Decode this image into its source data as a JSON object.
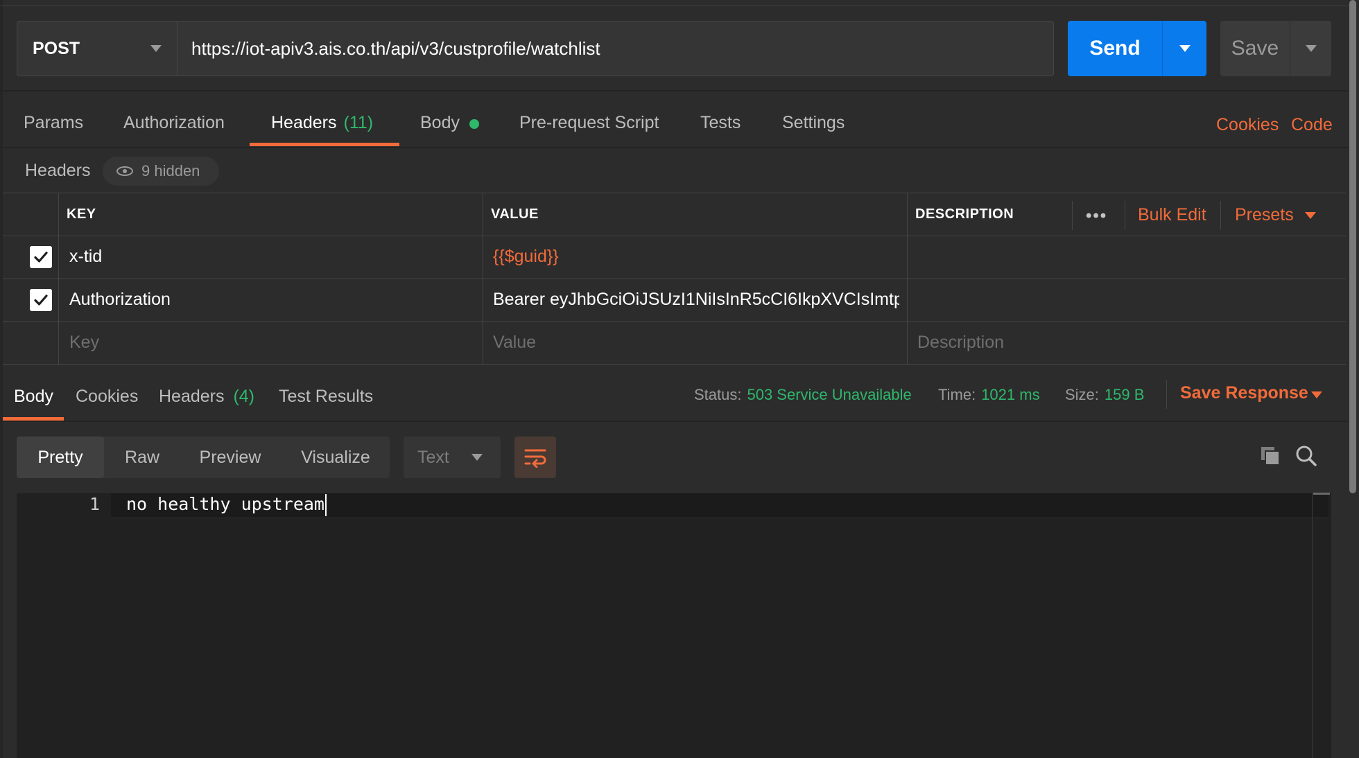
{
  "request": {
    "method": "POST",
    "url": "https://iot-apiv3.ais.co.th/api/v3/custprofile/watchlist",
    "send_label": "Send",
    "save_label": "Save"
  },
  "request_tabs": [
    {
      "label": "Params"
    },
    {
      "label": "Authorization"
    },
    {
      "label": "Headers",
      "count": "(11)",
      "active": true
    },
    {
      "label": "Body",
      "indicator": "green-dot"
    },
    {
      "label": "Pre-request Script"
    },
    {
      "label": "Tests"
    },
    {
      "label": "Settings"
    }
  ],
  "right_links": {
    "cookies": "Cookies",
    "code": "Code"
  },
  "headers_section": {
    "label": "Headers",
    "hidden": "9 hidden",
    "columns": {
      "key": "KEY",
      "value": "VALUE",
      "description": "DESCRIPTION"
    },
    "more_icon": "more-horizontal-icon",
    "bulk_edit": "Bulk Edit",
    "presets": "Presets",
    "rows": [
      {
        "checked": true,
        "key": "x-tid",
        "value": "{{$guid}}",
        "description": ""
      },
      {
        "checked": true,
        "key": "Authorization",
        "value": "Bearer eyJhbGciOiJSUzI1NiIsInR5cCI6IkpXVCIsImtp ...",
        "description": ""
      }
    ],
    "placeholders": {
      "key": "Key",
      "value": "Value",
      "description": "Description"
    }
  },
  "response_tabs": [
    {
      "label": "Body",
      "active": true
    },
    {
      "label": "Cookies"
    },
    {
      "label": "Headers",
      "count": "(4)"
    },
    {
      "label": "Test Results"
    }
  ],
  "response_meta": {
    "status_label": "Status:",
    "status_value": "503 Service Unavailable",
    "time_label": "Time:",
    "time_value": "1021 ms",
    "size_label": "Size:",
    "size_value": "159 B",
    "save_response": "Save Response"
  },
  "view_modes": [
    "Pretty",
    "Raw",
    "Preview",
    "Visualize"
  ],
  "active_view": "Pretty",
  "format": "Text",
  "icons": {
    "wrap": "wrap-lines-icon",
    "copy": "copy-icon",
    "search": "search-icon"
  },
  "editor": {
    "line_number": "1",
    "content": "no healthy upstream"
  },
  "colors": {
    "accent": "#f26b3a",
    "primary": "#097bed",
    "success": "#2eb86c",
    "background": "#2c2c2c"
  }
}
